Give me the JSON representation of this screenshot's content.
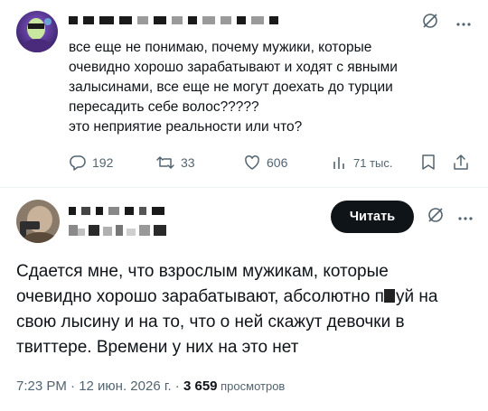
{
  "parent_tweet": {
    "text_lines": [
      "все еще не понимаю, почему мужики, которые",
      "очевидно хорошо зарабатывают и ходят с явными",
      "залысинами, все еще не могут доехать до турции",
      "пересадить себе волос?????",
      "это неприятие реальности или что?"
    ],
    "replies": "192",
    "reposts": "33",
    "likes": "606",
    "views": "71 тыс."
  },
  "main_tweet": {
    "read_button": "Читать",
    "text_lines": {
      "l1": "Сдается мне, что взрослым мужикам, которые",
      "l2_a": "очевидно хорошо зарабатывают, абсолютно п",
      "l2_b": "уй на",
      "l3": "свою лысину и на то, что о ней скажут девочки в",
      "l4": "твиттере. Времени у них на это нет"
    },
    "meta": {
      "time_date": "7:23 PM · 12 июн. 2026 г. · ",
      "views_count": "3 659",
      "views_label": " просмотров"
    }
  },
  "icons": {
    "grok": "grok-icon",
    "more": "more-icon",
    "reply": "reply-icon",
    "repost": "repost-icon",
    "like": "like-icon",
    "views": "views-icon",
    "bookmark": "bookmark-icon",
    "share": "share-icon"
  }
}
